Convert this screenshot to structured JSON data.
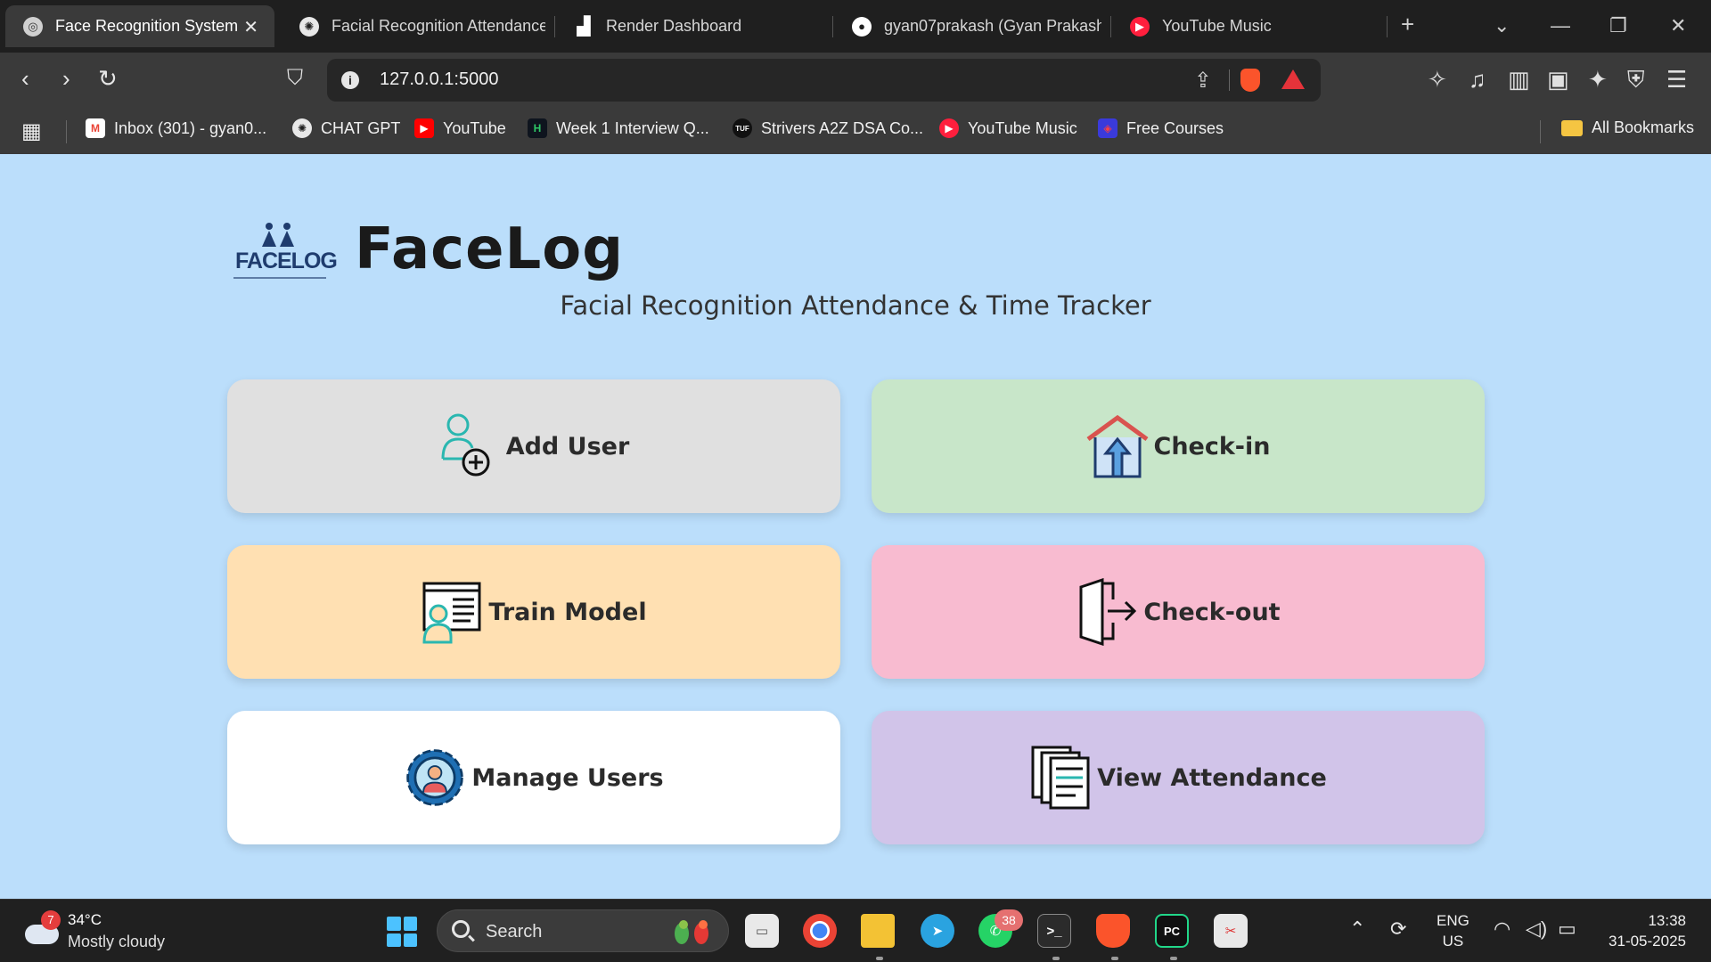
{
  "tabs": [
    {
      "title": "Face Recognition System",
      "icon": "globe-icon",
      "active": true
    },
    {
      "title": "Facial Recognition Attendance",
      "icon": "chatgpt-icon"
    },
    {
      "title": "Render Dashboard",
      "icon": "render-icon"
    },
    {
      "title": "gyan07prakash (Gyan Prakash",
      "icon": "github-icon"
    },
    {
      "title": "YouTube Music",
      "icon": "youtube-music-icon"
    }
  ],
  "address_bar": {
    "url": "127.0.0.1:5000"
  },
  "bookmarks": [
    {
      "label": "Inbox (301) - gyan0...",
      "icon": "gmail-icon"
    },
    {
      "label": "CHAT GPT",
      "icon": "chatgpt-icon"
    },
    {
      "label": "YouTube",
      "icon": "youtube-icon"
    },
    {
      "label": "Week 1 Interview Q...",
      "icon": "hackerrank-icon"
    },
    {
      "label": "Strivers A2Z DSA Co...",
      "icon": "tuf-icon"
    },
    {
      "label": "YouTube Music",
      "icon": "youtube-music-icon"
    },
    {
      "label": "Free Courses",
      "icon": "courses-icon"
    },
    {
      "label": "All Bookmarks",
      "icon": "folder-icon"
    }
  ],
  "app": {
    "logo_text": "FACELOG",
    "brand": "FaceLog",
    "subtitle": "Facial Recognition Attendance & Time Tracker",
    "cards": [
      {
        "label": "Add User",
        "color": "#e0e0e0",
        "icon": "add-user-icon"
      },
      {
        "label": "Check-in",
        "color": "#c8e6c9",
        "icon": "check-in-icon"
      },
      {
        "label": "Train Model",
        "color": "#ffe0b2",
        "icon": "train-model-icon"
      },
      {
        "label": "Check-out",
        "color": "#f8bbd0",
        "icon": "check-out-icon"
      },
      {
        "label": "Manage Users",
        "color": "#ffffff",
        "icon": "manage-users-icon"
      },
      {
        "label": "View Attendance",
        "color": "#d1c4e9",
        "icon": "view-attendance-icon"
      }
    ]
  },
  "taskbar": {
    "weather": {
      "badge": "7",
      "temp": "34°C",
      "condition": "Mostly cloudy"
    },
    "search_placeholder": "Search",
    "whatsapp_badge": "38",
    "language": {
      "line1": "ENG",
      "line2": "US"
    },
    "time": "13:38",
    "date": "31-05-2025"
  },
  "colors": {
    "page_bg": "#bbdefb",
    "tab_active": "#3a3a3a",
    "accent": "#4cc2ff"
  }
}
